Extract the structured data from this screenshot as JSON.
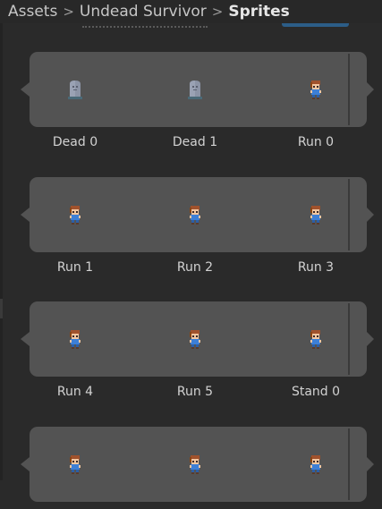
{
  "breadcrumb": {
    "items": [
      "Assets",
      "Undead Survivor",
      "Sprites"
    ]
  },
  "sprites": [
    {
      "label": "Dead 0",
      "icon": "tombstone-icon"
    },
    {
      "label": "Dead 1",
      "icon": "tombstone-icon"
    },
    {
      "label": "Run 0",
      "icon": "character-icon"
    },
    {
      "label": "Run 1",
      "icon": "character-icon"
    },
    {
      "label": "Run 2",
      "icon": "character-icon"
    },
    {
      "label": "Run 3",
      "icon": "character-icon"
    },
    {
      "label": "Run 4",
      "icon": "character-icon"
    },
    {
      "label": "Run 5",
      "icon": "character-icon"
    },
    {
      "label": "Stand 0",
      "icon": "character-icon"
    },
    {
      "label": "",
      "icon": "character-icon"
    },
    {
      "label": "",
      "icon": "character-icon"
    },
    {
      "label": "",
      "icon": "character-icon"
    }
  ],
  "colors": {
    "panel_bg": "#2a2a2a",
    "tile_bg": "#535353",
    "selection_accent": "#2c5d87",
    "label_text": "#d2d2d2"
  }
}
